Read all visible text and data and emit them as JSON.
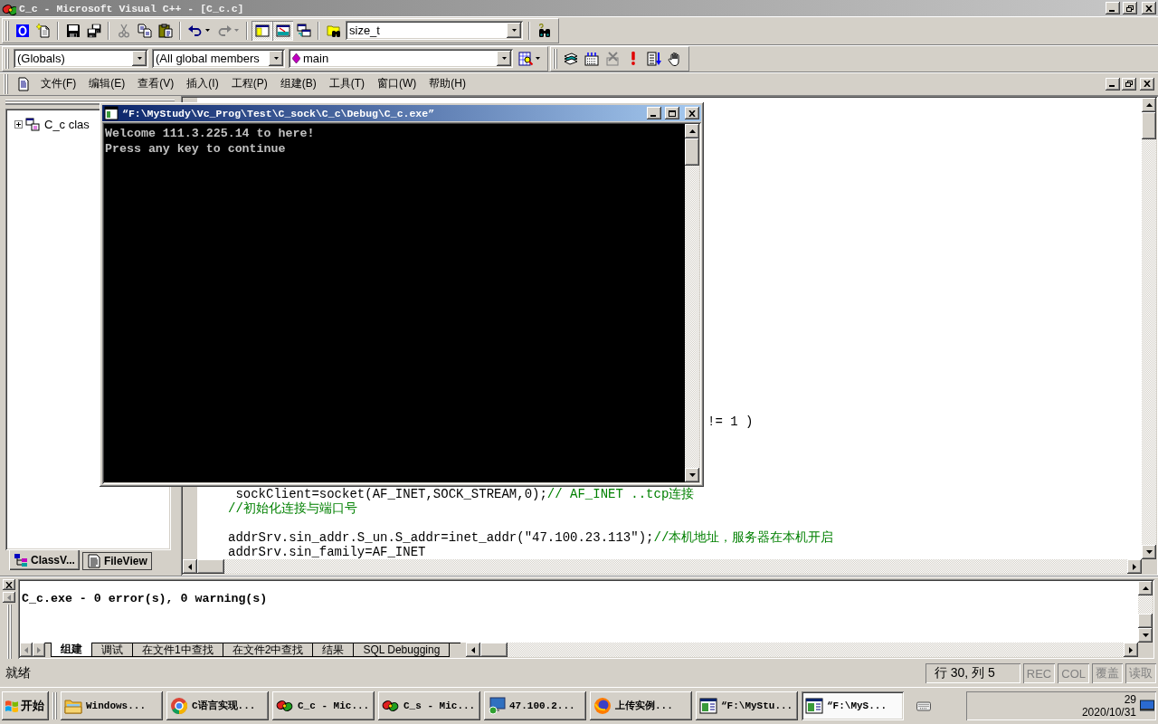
{
  "window": {
    "title": "C_c - Microsoft Visual C++ - [C_c.c]"
  },
  "toolbar_standard": {
    "groups": [
      [
        {
          "kind": "tile",
          "disabled": false,
          "pressed": false
        },
        {
          "kind": "newfile",
          "disabled": false,
          "pressed": false
        }
      ],
      [
        {
          "kind": "save",
          "disabled": false,
          "pressed": false
        },
        {
          "kind": "saveall",
          "disabled": false,
          "pressed": false
        }
      ],
      [
        {
          "kind": "cut",
          "disabled": true,
          "pressed": false
        },
        {
          "kind": "copy",
          "disabled": false,
          "pressed": false
        },
        {
          "kind": "paste",
          "disabled": false,
          "pressed": false
        }
      ],
      [
        {
          "kind": "undo",
          "disabled": false,
          "pressed": false
        },
        {
          "kind": "redo",
          "disabled": true,
          "pressed": false
        }
      ],
      [
        {
          "kind": "workspace",
          "disabled": false,
          "pressed": true
        },
        {
          "kind": "output",
          "disabled": false,
          "pressed": true
        },
        {
          "kind": "windows",
          "disabled": false,
          "pressed": false
        }
      ],
      [
        {
          "kind": "findfiles",
          "disabled": false,
          "pressed": false
        },
        {
          "kind": "findcombo",
          "value": "size_t",
          "disabled": false
        }
      ],
      [
        {
          "kind": "find",
          "disabled": false,
          "pressed": false
        }
      ]
    ]
  },
  "toolbar_wizard": {
    "groups": [
      [
        {
          "kind": "classcombo",
          "value": "(Globals)",
          "disabled": false
        },
        {
          "kind": "membercombo",
          "value": "(All global members",
          "disabled": false
        },
        {
          "kind": "functioncombo",
          "value": "main",
          "disabled": false
        },
        {
          "kind": "wizard",
          "disabled": false,
          "pressed": false
        }
      ]
    ]
  },
  "toolbar_build": {
    "groups": [
      [
        {
          "kind": "compile",
          "disabled": false,
          "pressed": false
        },
        {
          "kind": "build",
          "disabled": false,
          "pressed": false
        },
        {
          "kind": "stop",
          "disabled": true,
          "pressed": false
        },
        {
          "kind": "execute",
          "disabled": false,
          "pressed": false
        },
        {
          "kind": "go",
          "disabled": false,
          "pressed": false
        },
        {
          "kind": "breakpoint",
          "disabled": false,
          "pressed": false
        }
      ]
    ]
  },
  "menu": {
    "items": [
      "文件(F)",
      "编辑(E)",
      "查看(V)",
      "插入(I)",
      "工程(P)",
      "组建(B)",
      "工具(T)",
      "窗口(W)",
      "帮助(H)"
    ]
  },
  "workspace": {
    "tree": [
      {
        "label": "C_c clas",
        "expanded": false
      }
    ],
    "tabs": [
      {
        "kind": "classes",
        "label": "ClassV...",
        "selected": true
      },
      {
        "kind": "files",
        "label": "FileView",
        "selected": false
      }
    ]
  },
  "editor": {
    "blocks": [
      {
        "kind": "tail",
        "lines": [
          {
            "code": "!= 1 )"
          }
        ]
      },
      {
        "kind": "code",
        "lines": [
          {
            "code": " sockClient=socket(AF_INET,SOCK_STREAM,0);",
            "comment": "// AF_INET ..tcp连接"
          },
          {
            "comment": "//初始化连接与端口号"
          }
        ]
      },
      {
        "kind": "code",
        "lines": [
          {
            "code": "addrSrv.sin_addr.S_un.S_addr=inet_addr(\"47.100.23.113\");",
            "comment": "//本机地址，服务器在本机开启"
          },
          {
            "code": "addrSrv.sin_family=AF_INET"
          }
        ]
      }
    ]
  },
  "console_window": {
    "title": "“F:\\MyStudy\\Vc_Prog\\Test\\C_sock\\C_c\\Debug\\C_c.exe”",
    "lines": [
      "Welcome 111.3.225.14 to here!",
      "Press any key to continue"
    ]
  },
  "output": {
    "lines": [
      "C_c.exe - 0 error(s), 0 warning(s)"
    ],
    "tab_scroll_buttons": [
      {
        "kind": "left",
        "disabled": true
      },
      {
        "kind": "right",
        "disabled": true
      }
    ],
    "tabs": [
      {
        "label": "组建",
        "selected": true
      },
      {
        "label": "调试",
        "selected": false
      },
      {
        "label": "在文件1中查找",
        "selected": false
      },
      {
        "label": "在文件2中查找",
        "selected": false
      },
      {
        "label": "结果",
        "selected": false
      },
      {
        "label": "SQL Debugging",
        "selected": false
      }
    ]
  },
  "status_bar": {
    "message": "就绪",
    "position": "行 30, 列 5",
    "indicators": [
      {
        "label": "REC",
        "active": false
      },
      {
        "label": "COL",
        "active": false
      },
      {
        "label": "覆盖",
        "active": false
      },
      {
        "label": "读取",
        "active": false
      }
    ]
  },
  "taskbar": {
    "start": "开始",
    "tasks": [
      {
        "kind": "folder",
        "label": "Windows...",
        "selected": false
      },
      {
        "kind": "wheel",
        "label": "C语言实现...",
        "selected": false
      },
      {
        "kind": "loops",
        "label": "C_c - Mic...",
        "selected": false
      },
      {
        "kind": "loops",
        "label": "C_s - Mic...",
        "selected": false
      },
      {
        "kind": "monitor",
        "label": "47.100.2...",
        "selected": false
      },
      {
        "kind": "globe",
        "label": "上传实例...",
        "selected": false
      },
      {
        "kind": "window",
        "label": "“F:\\MyStu...",
        "selected": false
      },
      {
        "kind": "window",
        "label": "“F:\\MyS...",
        "selected": true
      }
    ],
    "clock": {
      "time": "29",
      "date": "2020/10/31"
    }
  }
}
